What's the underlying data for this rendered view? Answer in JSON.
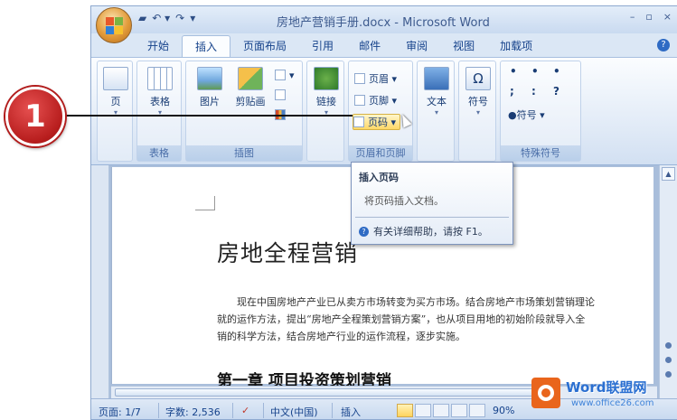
{
  "callout": {
    "number": "1"
  },
  "window": {
    "title": "房地产营销手册.docx - Microsoft Word",
    "controls": [
      "–",
      "▫",
      "×"
    ]
  },
  "tabs": [
    {
      "label": "开始"
    },
    {
      "label": "插入",
      "active": true
    },
    {
      "label": "页面布局"
    },
    {
      "label": "引用"
    },
    {
      "label": "邮件"
    },
    {
      "label": "审阅"
    },
    {
      "label": "视图"
    },
    {
      "label": "加载项"
    }
  ],
  "ribbon": {
    "page": {
      "label": "页"
    },
    "table": {
      "label": "表格",
      "group": "表格"
    },
    "picture": {
      "label": "图片"
    },
    "clipart": {
      "label": "剪贴画"
    },
    "illustrations_group": "插图",
    "link": {
      "label": "链接"
    },
    "header": {
      "label": "页眉"
    },
    "footer": {
      "label": "页脚"
    },
    "page_number": {
      "label": "页码"
    },
    "header_footer_group": "页眉和页脚",
    "text": {
      "label": "文本"
    },
    "symbol": {
      "label": "符号"
    },
    "special_symbols": {
      "label": "符号",
      "group": "特殊符号"
    }
  },
  "tooltip": {
    "title": "插入页码",
    "description": "将页码插入文档。",
    "help": "有关详细帮助，请按 F1。"
  },
  "document": {
    "title": "房地全程营销",
    "paragraph": [
      "现在中国房地产产业已从卖方市场转变为买方市场。结合房地产市场策划营销理论",
      "就的运作方法，提出“房地产全程策划营销方案”，也从项目用地的初始阶段就导入全",
      "销的科学方法，结合房地产行业的运作流程，逐步实施。"
    ],
    "heading": "第一章 项目投资策划营销"
  },
  "status": {
    "page": "页面: 1/7",
    "words": "字数: 2,536",
    "language": "中文(中国)",
    "mode": "插入",
    "zoom": "90%"
  },
  "watermark": {
    "line1": "Word联盟网",
    "line2": "www.office26.com"
  }
}
